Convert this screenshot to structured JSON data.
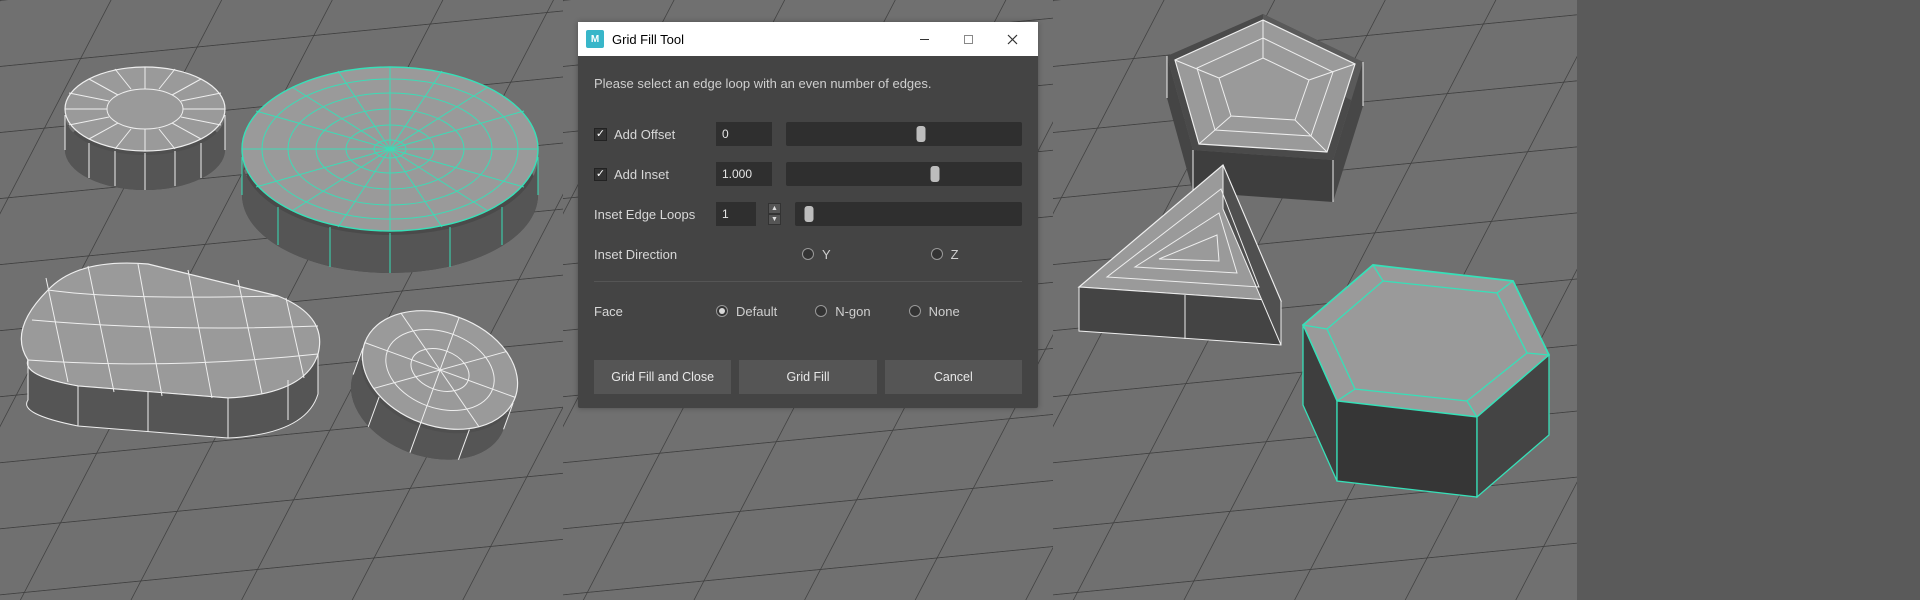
{
  "dialog": {
    "app_icon_letter": "M",
    "title": "Grid Fill Tool",
    "instruction": "Please select an edge loop with an even number of edges.",
    "add_offset": {
      "label": "Add Offset",
      "checked": true,
      "value": "0",
      "slider_pos": 0.57
    },
    "add_inset": {
      "label": "Add Inset",
      "checked": true,
      "value": "1.000",
      "slider_pos": 0.63
    },
    "inset_loops": {
      "label": "Inset Edge Loops",
      "value": "1",
      "slider_pos": 0.06
    },
    "inset_direction": {
      "label": "Inset Direction",
      "options": [
        "Y",
        "Z"
      ],
      "selected": null
    },
    "face": {
      "label": "Face",
      "options": [
        "Default",
        "N-gon",
        "None"
      ],
      "selected": "Default"
    },
    "buttons": {
      "apply_close": "Grid Fill and Close",
      "apply": "Grid Fill",
      "cancel": "Cancel"
    }
  },
  "colors": {
    "wire_white": "#eeeeee",
    "wire_sel": "#37e0b8",
    "shade_top": "#9a9a9a",
    "shade_side": "#5a5a5a",
    "grid_line": "#404040"
  }
}
